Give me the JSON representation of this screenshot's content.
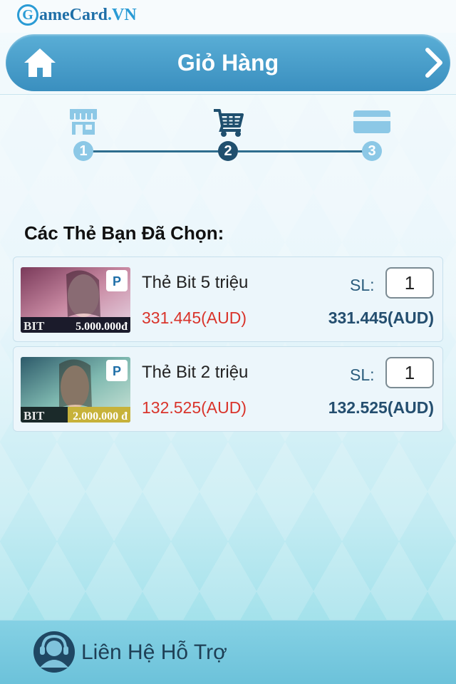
{
  "brand": {
    "logo_letter": "G",
    "logo_main": "ameCard",
    "logo_suffix": ".VN"
  },
  "header": {
    "title": "Giỏ Hàng",
    "home_icon": "home-icon",
    "next_icon": "chevron-right-icon"
  },
  "steps": [
    {
      "number": "1",
      "icon": "store-icon",
      "state": "done"
    },
    {
      "number": "2",
      "icon": "cart-icon",
      "state": "active"
    },
    {
      "number": "3",
      "icon": "credit-card-icon",
      "state": "pending"
    }
  ],
  "section_title": "Các Thẻ Bạn Đã Chọn:",
  "cart_items": [
    {
      "name": "Thẻ Bit 5 triệu",
      "unit_price": "331.445(AUD)",
      "qty_label": "SL:",
      "qty": "1",
      "total": "331.445(AUD)",
      "thumb_brand": "BIT",
      "thumb_value": "5.000.000đ"
    },
    {
      "name": "Thẻ Bit 2 triệu",
      "unit_price": "132.525(AUD)",
      "qty_label": "SL:",
      "qty": "1",
      "total": "132.525(AUD)",
      "thumb_brand": "BIT",
      "thumb_value": "2.000.000 đ"
    }
  ],
  "footer": {
    "support_label": "Liên Hệ Hỗ Trợ",
    "icon": "support-agent-icon"
  },
  "colors": {
    "header": "#3a8fbf",
    "accent": "#2a9bd5",
    "price": "#d9342b",
    "total": "#244e6f",
    "step_active": "#1f4f6e",
    "step_idle": "#8cc8e6"
  }
}
